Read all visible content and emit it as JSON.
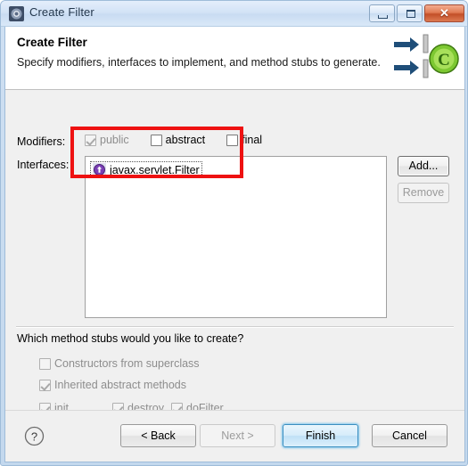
{
  "window": {
    "title": "Create Filter",
    "icon": "eclipse-wizard-icon",
    "controls": {
      "minimize": "minimize-icon",
      "maximize": "maximize-icon",
      "close": "✕"
    }
  },
  "header": {
    "title": "Create Filter",
    "description": "Specify modifiers, interfaces to implement, and method stubs to generate.",
    "art": "filter-wizard-banner-icon"
  },
  "form": {
    "modifiers_label": "Modifiers:",
    "modifiers": [
      {
        "label": "public",
        "checked": true,
        "enabled": false,
        "mnemonic": "p"
      },
      {
        "label": "abstract",
        "checked": false,
        "enabled": true,
        "mnemonic": "a"
      },
      {
        "label": "final",
        "checked": false,
        "enabled": true,
        "mnemonic": "l"
      }
    ],
    "interfaces_label": "Interfaces:",
    "interfaces": [
      {
        "name": "javax.servlet.Filter",
        "icon": "java-interface-icon",
        "selected": true
      }
    ],
    "add_button": "Add...",
    "remove_button": "Remove",
    "add_enabled": true,
    "remove_enabled": false
  },
  "stubs": {
    "question": "Which method stubs would you like to create?",
    "options": [
      {
        "label": "Constructors from superclass",
        "checked": false,
        "enabled": false,
        "mnemonic": "C"
      },
      {
        "label": "Inherited abstract methods",
        "checked": true,
        "enabled": false,
        "mnemonic": "h"
      }
    ],
    "methods": [
      {
        "label": "init",
        "checked": true,
        "enabled": false
      },
      {
        "label": "destroy",
        "checked": true,
        "enabled": false
      },
      {
        "label": "doFilter",
        "checked": true,
        "enabled": false
      }
    ]
  },
  "footer": {
    "help": "?",
    "buttons": [
      {
        "label": "< Back",
        "enabled": true,
        "default": false
      },
      {
        "label": "Next >",
        "enabled": false,
        "default": false
      },
      {
        "label": "Finish",
        "enabled": true,
        "default": true
      },
      {
        "label": "Cancel",
        "enabled": true,
        "default": false
      }
    ]
  },
  "annotation": {
    "color": "#ee1111",
    "shape": "rectangle-highlight"
  }
}
